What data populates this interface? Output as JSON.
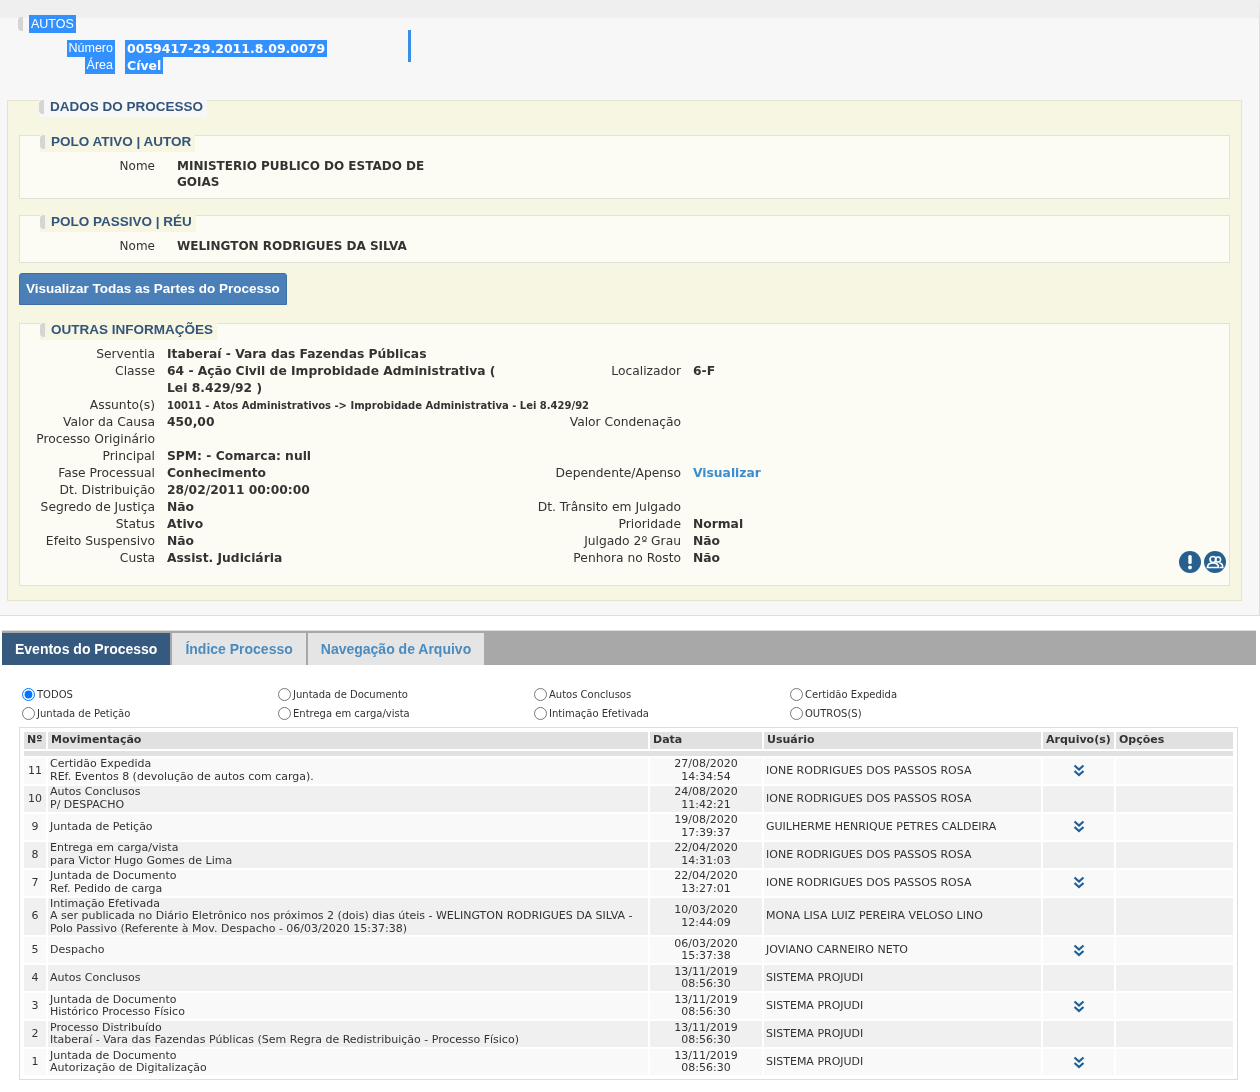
{
  "autos": {
    "title": "AUTOS",
    "highlighted": true,
    "fields": [
      {
        "label": "Número",
        "value": "0059417-29.2011.8.09.0079"
      },
      {
        "label": "Área",
        "value": "Cível"
      }
    ]
  },
  "dados": {
    "title": "DADOS DO PROCESSO",
    "polos": [
      {
        "title": "POLO ATIVO | AUTOR",
        "label": "Nome",
        "value": "MINISTERIO PUBLICO DO ESTADO DE GOIAS"
      },
      {
        "title": "POLO PASSIVO | RÉU",
        "label": "Nome",
        "value": "WELINGTON RODRIGUES DA SILVA"
      }
    ],
    "button": "Visualizar Todas as Partes do Processo",
    "outras": {
      "title": "OUTRAS INFORMAÇÕES",
      "rows": [
        {
          "label": "Serventia",
          "value": "Itaberaí - Vara das Fazendas Públicas"
        },
        {
          "label": "Classe",
          "value": "64 - Ação Civil de Improbidade Administrativa ( Lei 8.429/92 )",
          "right_label": "Localizador",
          "right_value": "6-F"
        },
        {
          "label": "Assunto(s)",
          "value": "10011 - Atos Administrativos -> Improbidade Administrativa - Lei 8.429/92",
          "kind": "small"
        },
        {
          "label": "Valor da Causa",
          "value": "450,00",
          "right_label": "Valor Condenação"
        },
        {
          "label": "Processo Originário"
        },
        {
          "label": "Principal",
          "value": "SPM: - Comarca: null"
        },
        {
          "label": "Fase Processual",
          "value": "Conhecimento",
          "right_label": "Dependente/Apenso",
          "right_link": "Visualizar"
        },
        {
          "label": "Dt. Distribuição",
          "value": "28/02/2011 00:00:00"
        },
        {
          "label": "Segredo de Justiça",
          "value": "Não",
          "right_label": "Dt. Trânsito em Julgado"
        },
        {
          "label": "Status",
          "value": "Ativo",
          "right_label": "Prioridade",
          "right_value": "Normal"
        },
        {
          "label": "Efeito Suspensivo",
          "value": "Não",
          "right_label": "Julgado 2º Grau",
          "right_value": "Não"
        },
        {
          "label": "Custa",
          "value": "Assist. Judiciária",
          "right_label": "Penhora no Rosto",
          "right_value": "Não"
        }
      ]
    }
  },
  "tabs": [
    {
      "label": "Eventos do Processo",
      "selected": true
    },
    {
      "label": "Índice Processo",
      "selected": false
    },
    {
      "label": "Navegação de Arquivo",
      "selected": false
    }
  ],
  "filters": [
    {
      "label": "TODOS",
      "selected": true
    },
    {
      "label": "Juntada de Documento",
      "selected": false
    },
    {
      "label": "Autos Conclusos",
      "selected": false
    },
    {
      "label": "Certidão Expedida",
      "selected": false
    },
    {
      "label": "Juntada de Petição",
      "selected": false
    },
    {
      "label": "Entrega em carga/vista",
      "selected": false
    },
    {
      "label": "Intimação Efetivada",
      "selected": false
    },
    {
      "label": "OUTROS(S)",
      "selected": false
    }
  ],
  "table": {
    "columns": [
      "Nº",
      "Movimentação",
      "Data",
      "Usuário",
      "Arquivo(s)",
      "Opções"
    ],
    "rows": [
      {
        "n": "11",
        "title": "Certidão Expedida",
        "detail": "REf. Eventos 8 (devolução de autos com carga).",
        "date": "27/08/2020",
        "time": "14:34:54",
        "user": "IONE RODRIGUES DOS PASSOS ROSA",
        "file": true
      },
      {
        "n": "10",
        "title": "Autos Conclusos",
        "detail": "P/ DESPACHO",
        "date": "24/08/2020",
        "time": "11:42:21",
        "user": "IONE RODRIGUES DOS PASSOS ROSA",
        "file": false
      },
      {
        "n": "9",
        "title": "Juntada de Petição",
        "date": "19/08/2020",
        "time": "17:39:37",
        "user": "GUILHERME HENRIQUE PETRES CALDEIRA",
        "file": true
      },
      {
        "n": "8",
        "title": "Entrega em carga/vista",
        "detail": "para Victor Hugo Gomes de Lima",
        "date": "22/04/2020",
        "time": "14:31:03",
        "user": "IONE RODRIGUES DOS PASSOS ROSA",
        "file": false
      },
      {
        "n": "7",
        "title": "Juntada de Documento",
        "detail": "Ref. Pedido de carga",
        "date": "22/04/2020",
        "time": "13:27:01",
        "user": "IONE RODRIGUES DOS PASSOS ROSA",
        "file": true
      },
      {
        "n": "6",
        "title": "Intimação Efetivada",
        "detail": "A ser publicada no Diário Eletrônico nos próximos 2 (dois) dias úteis - WELINGTON RODRIGUES DA SILVA - Polo Passivo (Referente à Mov. Despacho - 06/03/2020 15:37:38)",
        "date": "10/03/2020",
        "time": "12:44:09",
        "user": "MONA LISA LUIZ PEREIRA VELOSO LINO",
        "file": false
      },
      {
        "n": "5",
        "title": "Despacho",
        "date": "06/03/2020",
        "time": "15:37:38",
        "user": "JOVIANO CARNEIRO NETO",
        "file": true
      },
      {
        "n": "4",
        "title": "Autos Conclusos",
        "date": "13/11/2019",
        "time": "08:56:30",
        "user": "SISTEMA PROJUDI",
        "file": false
      },
      {
        "n": "3",
        "title": "Juntada de Documento",
        "detail": "Histórico Processo Físico",
        "date": "13/11/2019",
        "time": "08:56:30",
        "user": "SISTEMA PROJUDI",
        "file": true
      },
      {
        "n": "2",
        "title": "Processo Distribuído",
        "detail": "Itaberaí - Vara das Fazendas Públicas (Sem Regra de Redistribuição - Processo Físico)",
        "date": "13/11/2019",
        "time": "08:56:30",
        "user": "SISTEMA PROJUDI",
        "file": false
      },
      {
        "n": "1",
        "title": "Juntada de Documento",
        "detail": "Autorização de Digitalização",
        "date": "13/11/2019",
        "time": "08:56:30",
        "user": "SISTEMA PROJUDI",
        "file": true
      }
    ]
  }
}
